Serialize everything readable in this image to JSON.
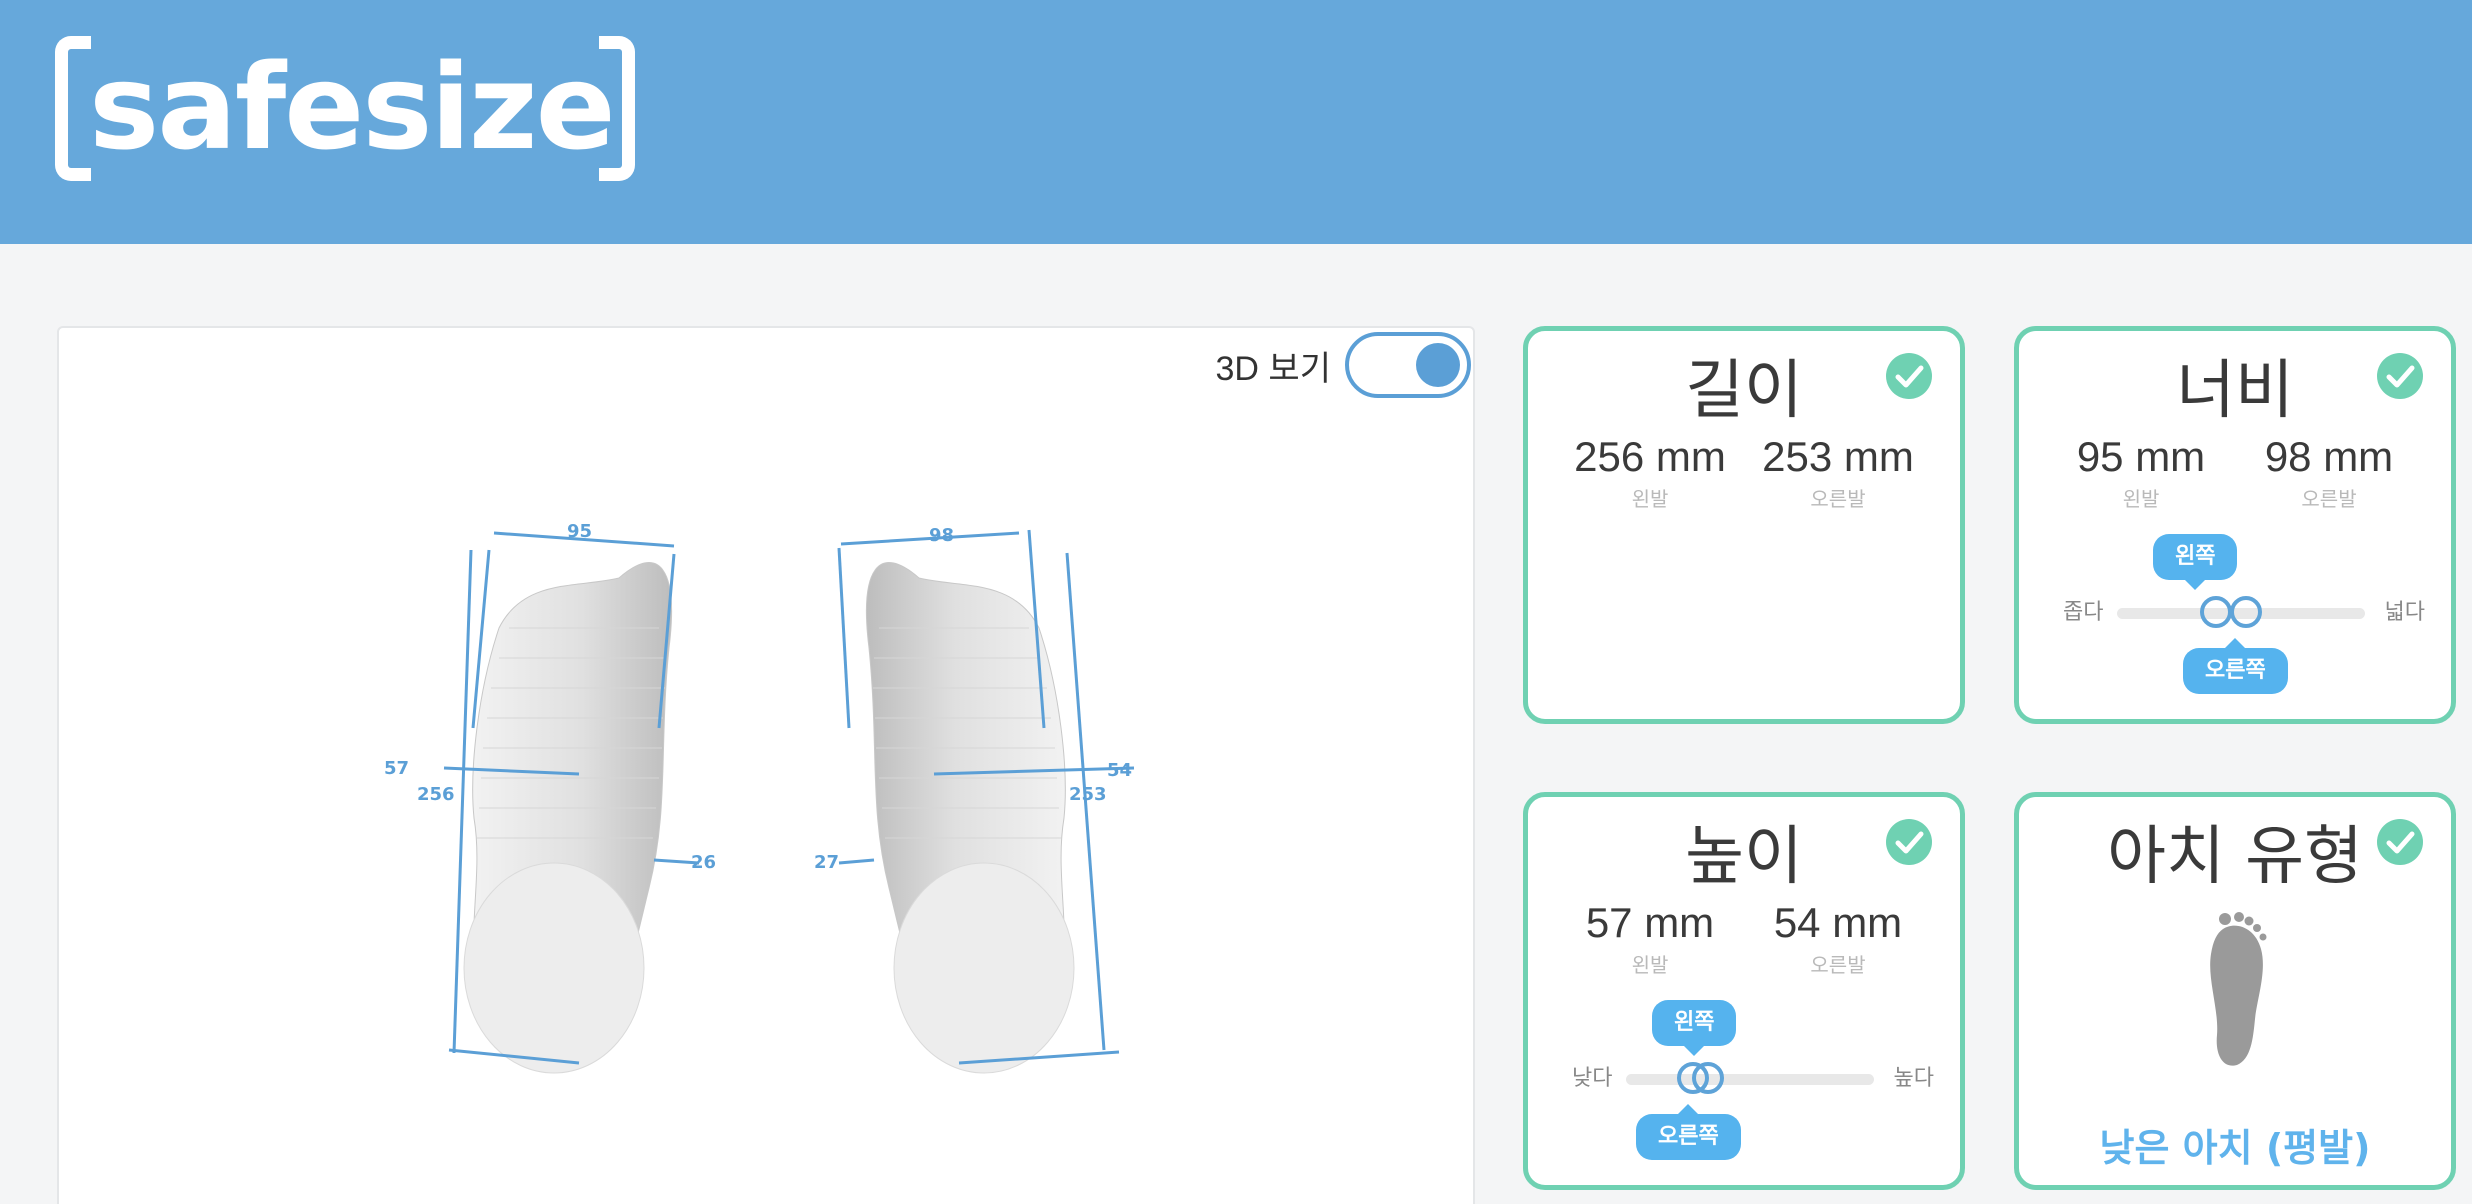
{
  "header": {
    "logo_text": "safesize"
  },
  "viewer": {
    "toggle_label": "3D 보기",
    "toggle_on": true,
    "annotations": {
      "left_width": "95",
      "right_width": "98",
      "left_length": "256",
      "right_length": "253",
      "left_height": "57",
      "right_height": "54",
      "left_instep": "26",
      "right_instep": "27"
    }
  },
  "cards": {
    "length": {
      "title": "길이",
      "left_value": "256 mm",
      "left_label": "왼발",
      "right_value": "253 mm",
      "right_label": "오른발"
    },
    "width": {
      "title": "너비",
      "left_value": "95 mm",
      "left_label": "왼발",
      "right_value": "98 mm",
      "right_label": "오른발",
      "scale_low": "좁다",
      "scale_high": "넓다",
      "marker_left": "왼쪽",
      "marker_right": "오른쪽",
      "left_level": 0.4,
      "right_level": 0.52
    },
    "height": {
      "title": "높이",
      "left_value": "57 mm",
      "left_label": "왼발",
      "right_value": "54 mm",
      "right_label": "오른발",
      "scale_low": "낮다",
      "scale_high": "높다",
      "marker_left": "왼쪽",
      "marker_right": "오른쪽",
      "left_level": 0.33,
      "right_level": 0.27
    },
    "arch": {
      "title": "아치 유형",
      "type_label": "낮은 아치 (평발)"
    }
  },
  "colors": {
    "header": "#66a8db",
    "accent": "#6fd1b2",
    "marker": "#55b3ee",
    "annotation": "#5b9fd6"
  },
  "icons": [
    "check-icon",
    "foot-icon"
  ]
}
